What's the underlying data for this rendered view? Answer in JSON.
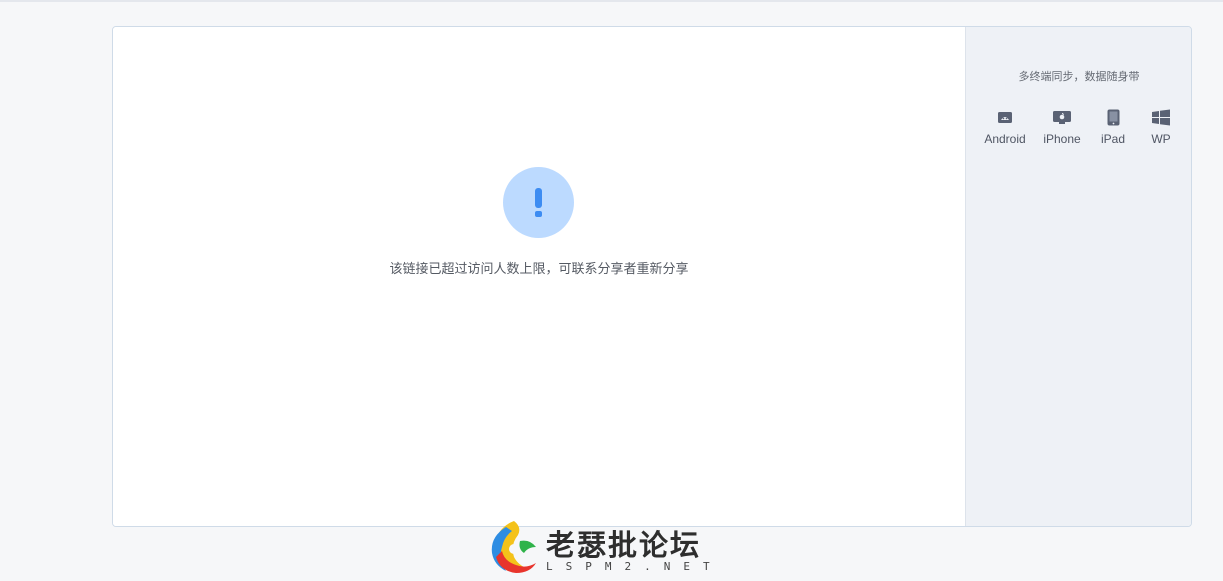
{
  "main": {
    "message": "该链接已超过访问人数上限，可联系分享者重新分享"
  },
  "sidebar": {
    "title": "多终端同步，数据随身带",
    "platforms": [
      {
        "label": "Android",
        "icon": "android-icon"
      },
      {
        "label": "iPhone",
        "icon": "iphone-icon"
      },
      {
        "label": "iPad",
        "icon": "ipad-icon"
      },
      {
        "label": "WP",
        "icon": "windows-icon"
      }
    ]
  },
  "watermark": {
    "title": "老瑟批论坛",
    "subtitle": "LSPM2.NET"
  },
  "colors": {
    "accent": "#3d8cf2",
    "alert_bg": "#bcdaff",
    "sidebar_bg": "#eef1f6",
    "border": "#cfdbe8"
  }
}
